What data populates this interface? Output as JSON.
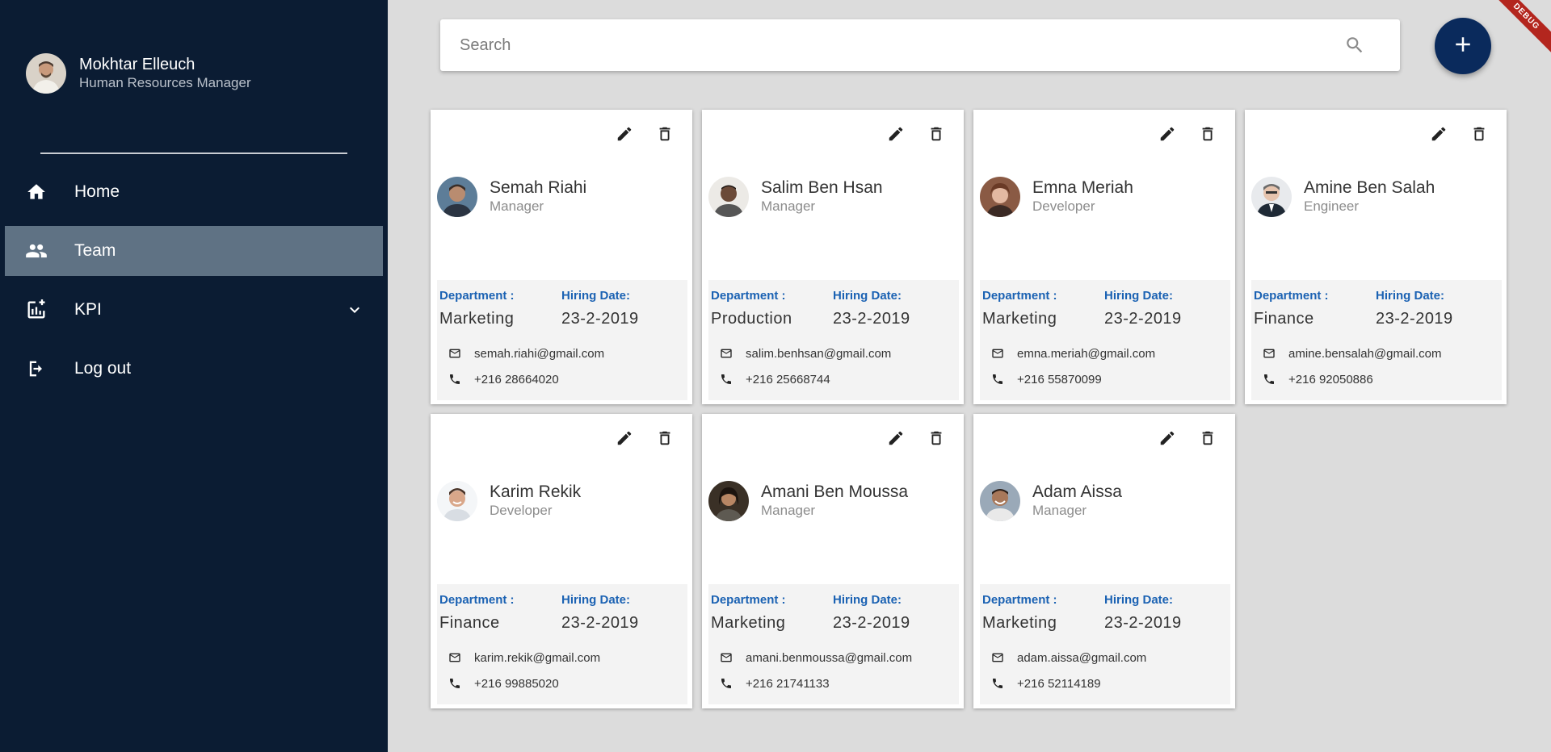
{
  "user": {
    "name": "Mokhtar Elleuch",
    "role": "Human Resources Manager"
  },
  "nav": {
    "items": [
      {
        "label": "Home",
        "icon": "home-icon",
        "active": false
      },
      {
        "label": "Team",
        "icon": "team-icon",
        "active": true
      },
      {
        "label": "KPI",
        "icon": "kpi-icon",
        "active": false,
        "expandable": true
      },
      {
        "label": "Log out",
        "icon": "logout-icon",
        "active": false
      }
    ]
  },
  "search": {
    "placeholder": "Search",
    "value": ""
  },
  "debug_banner": "DEBUG",
  "labels": {
    "department": "Department :",
    "hiring_date": "Hiring Date:"
  },
  "employees": [
    {
      "name": "Semah Riahi",
      "role": "Manager",
      "department": "Marketing",
      "hiring_date": "23-2-2019",
      "email": "semah.riahi@gmail.com",
      "phone": "+216 28664020"
    },
    {
      "name": "Salim Ben Hsan",
      "role": "Manager",
      "department": "Production",
      "hiring_date": "23-2-2019",
      "email": "salim.benhsan@gmail.com",
      "phone": "+216 25668744"
    },
    {
      "name": "Emna Meriah",
      "role": "Developer",
      "department": "Marketing",
      "hiring_date": "23-2-2019",
      "email": "emna.meriah@gmail.com",
      "phone": "+216 55870099"
    },
    {
      "name": "Amine Ben Salah",
      "role": "Engineer",
      "department": "Finance",
      "hiring_date": "23-2-2019",
      "email": "amine.bensalah@gmail.com",
      "phone": "+216 92050886"
    },
    {
      "name": "Karim Rekik",
      "role": "Developer",
      "department": "Finance",
      "hiring_date": "23-2-2019",
      "email": "karim.rekik@gmail.com",
      "phone": "+216 99885020"
    },
    {
      "name": "Amani Ben Moussa",
      "role": "Manager",
      "department": "Marketing",
      "hiring_date": "23-2-2019",
      "email": "amani.benmoussa@gmail.com",
      "phone": "+216 21741133"
    },
    {
      "name": "Adam Aissa",
      "role": "Manager",
      "department": "Marketing",
      "hiring_date": "23-2-2019",
      "email": "adam.aissa@gmail.com",
      "phone": "+216 52114189"
    }
  ],
  "colors": {
    "sidebar": "#0b1c33",
    "active_nav": "#5f7284",
    "accent": "#1b62b3",
    "fab": "#0a2a5c",
    "background": "#dcdcdc"
  }
}
